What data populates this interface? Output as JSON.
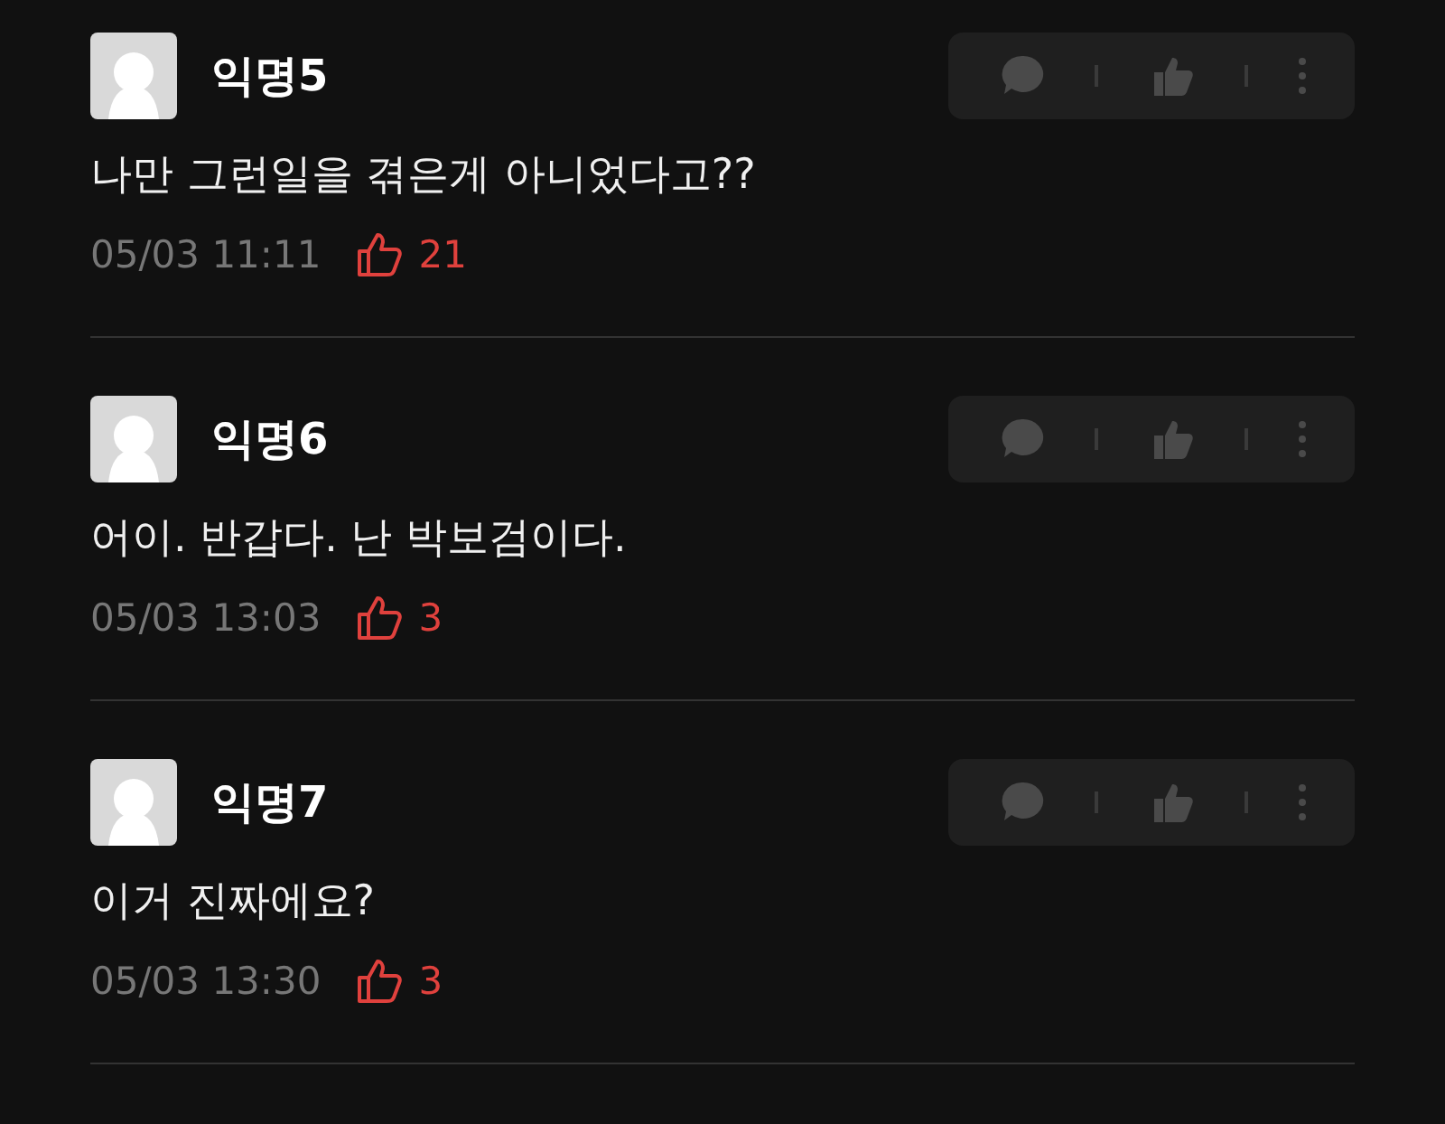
{
  "comments": [
    {
      "author": "익명5",
      "text": "나만 그런일을 겪은게 아니었다고??",
      "time": "05/03 11:11",
      "likes": "21"
    },
    {
      "author": "익명6",
      "text": "어이. 반갑다. 난 박보검이다.",
      "time": "05/03 13:03",
      "likes": "3"
    },
    {
      "author": "익명7",
      "text": "이거 진짜에요?",
      "time": "05/03 13:30",
      "likes": "3"
    }
  ]
}
